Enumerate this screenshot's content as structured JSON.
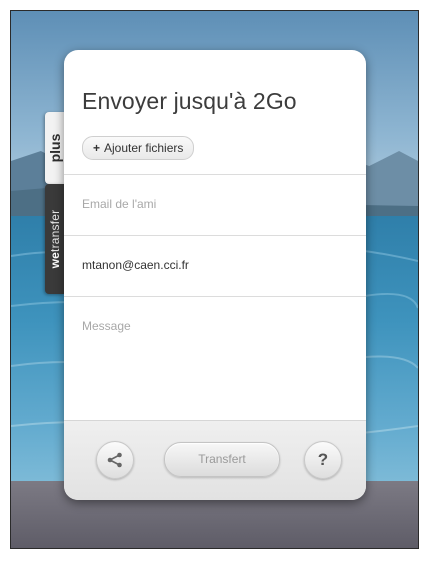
{
  "side_tabs": {
    "plus_label": "plus",
    "wetransfer_bold": "we",
    "wetransfer_rest": "transfer"
  },
  "panel": {
    "title": "Envoyer jusqu'à 2Go",
    "add_files_label": "Ajouter fichiers",
    "add_files_prefix": "+",
    "email_placeholder": "Email de l'ami",
    "your_email_value": "mtanon@caen.cci.fr",
    "message_placeholder": "Message",
    "transfer_button_label": "Transfert",
    "help_button_label": "?"
  },
  "icons": {
    "share": "share-icon"
  },
  "colors": {
    "tab_dark": "#3a3a3a",
    "tab_light": "#f2f2f2",
    "panel_bg": "#ffffff"
  }
}
